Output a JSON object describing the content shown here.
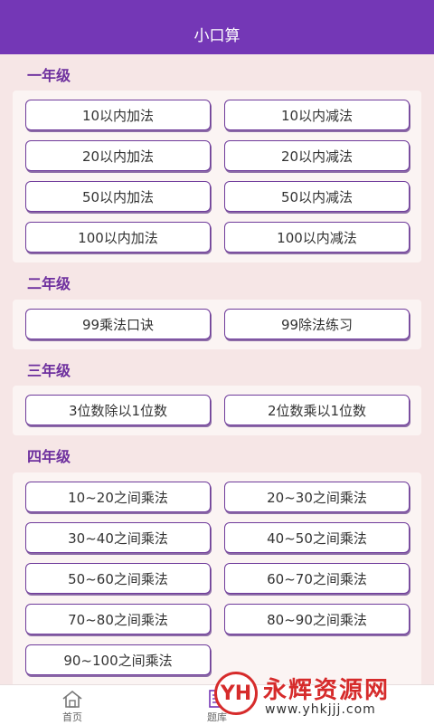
{
  "header": {
    "title": "小口算"
  },
  "sections": {
    "grade1": {
      "title": "一年级",
      "buttons": [
        "10以内加法",
        "10以内减法",
        "20以内加法",
        "20以内减法",
        "50以内加法",
        "50以内减法",
        "100以内加法",
        "100以内减法"
      ]
    },
    "grade2": {
      "title": "二年级",
      "buttons": [
        "99乘法口诀",
        "99除法练习"
      ]
    },
    "grade3": {
      "title": "三年级",
      "buttons": [
        "3位数除以1位数",
        "2位数乘以1位数"
      ]
    },
    "grade4": {
      "title": "四年级",
      "buttons": [
        "10~20之间乘法",
        "20~30之间乘法",
        "30~40之间乘法",
        "40~50之间乘法",
        "50~60之间乘法",
        "60~70之间乘法",
        "70~80之间乘法",
        "80~90之间乘法",
        "90~100之间乘法"
      ]
    }
  },
  "bottom_nav": {
    "items": [
      {
        "label": "首页",
        "icon": "home-icon"
      },
      {
        "label": "题库",
        "icon": "question-bank-icon"
      }
    ]
  },
  "watermark": {
    "logo_text": "YH",
    "text": "永辉资源网",
    "url": "www.yhkjjj.com"
  },
  "colors": {
    "header_bg": "#7437b6",
    "section_title": "#6d2f9e",
    "button_border": "#6f3b9b",
    "page_bg": "#f6e6e6"
  }
}
